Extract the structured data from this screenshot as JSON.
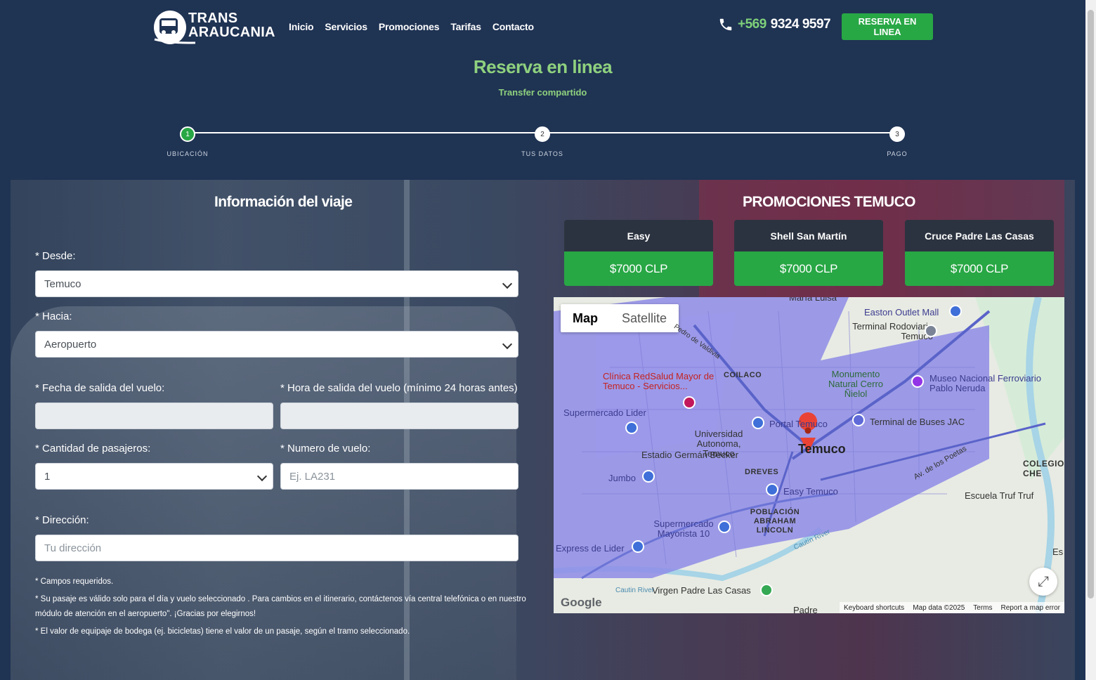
{
  "header": {
    "logo_line1": "TRANS",
    "logo_line2": "ARAUCANIA",
    "nav": [
      "Inicio",
      "Servicios",
      "Promociones",
      "Tarifas",
      "Contacto"
    ],
    "phone_prefix": "+569",
    "phone_number": "9324 9597",
    "book_button": "RESERVA EN LINEA"
  },
  "hero": {
    "title": "Reserva en linea",
    "subtitle": "Transfer compartido"
  },
  "steps": [
    {
      "num": "1",
      "label": "UBICACIÓN"
    },
    {
      "num": "2",
      "label": "TUS DATOS"
    },
    {
      "num": "3",
      "label": "PAGO"
    }
  ],
  "form": {
    "title": "Información del viaje",
    "desde_label": "* Desde:",
    "desde_value": " Temuco",
    "hacia_label": "* Hacia:",
    "hacia_value": " Aeropuerto",
    "fecha_label": "* Fecha de salida del vuelo:",
    "hora_label": "* Hora de salida del vuelo (mínimo 24 horas antes)",
    "pasajeros_label": "* Cantidad de pasajeros:",
    "pasajeros_value": "1",
    "vuelo_label": "* Numero de vuelo:",
    "vuelo_placeholder": "Ej. LA231",
    "direccion_label": "* Dirección:",
    "direccion_placeholder": "Tu dirección",
    "notes": [
      "* Campos requeridos.",
      "* Su pasaje es válido solo para el día y vuelo seleccionado . Para cambios en el itinerario, contáctenos vía central telefónica o en nuestro módulo de atención en el aeropuerto\". ¡Gracias por elegirnos!",
      "* El valor de equipaje de bodega (ej. bicicletas) tiene el valor de un pasaje, según el tramo seleccionado."
    ]
  },
  "promos": {
    "title": "PROMOCIONES TEMUCO",
    "items": [
      {
        "name": "Easy",
        "price": "$7000 CLP"
      },
      {
        "name": "Shell San Martín",
        "price": "$7000 CLP"
      },
      {
        "name": "Cruce Padre Las Casas",
        "price": "$7000 CLP"
      }
    ]
  },
  "map": {
    "tab_map": "Map",
    "tab_satellite": "Satellite",
    "labels": {
      "maria_luisa": "María Luisa",
      "easton": "Easton Outlet Mall",
      "terminal_rod": "Terminal Rodoviario Temuco",
      "monumento": "Monumento Natural Cerro Ñielol",
      "museo": "Museo Nacional Ferroviario Pablo Neruda",
      "coilaco": "COILACO",
      "clinica": "Clínica RedSalud Mayor de Temuco - Servicios...",
      "lider": "Supermercado Lider",
      "universidad": "Universidad Autonoma, Temuco",
      "portal": "Portal Temuco",
      "terminal_jac": "Terminal de Buses JAC",
      "estadio": "Estadio Germán Becker",
      "temuco": "Temuco",
      "dreves": "DREVES",
      "jumbo": "Jumbo",
      "easy": "Easy Temuco",
      "poblacion": "POBLACIÓN ABRAHAM LINCOLN",
      "mayorista": "Supermercado Mayorista 10",
      "express": "Express de Lider",
      "virgen": "Virgen Padre Las Casas",
      "padre": "Padre",
      "colegio": "COLEGIO CHE",
      "escuela": "Escuela Truf Truf",
      "poetas": "Av. de los Poetas",
      "cautin1": "Cautín River",
      "cautin2": "Cautin River",
      "valdivia": "Pedro de Valdivia",
      "es": "Es"
    },
    "google": "Google",
    "attrib": [
      "Keyboard shortcuts",
      "Map data ©2025",
      "Terms",
      "Report a map error"
    ]
  },
  "colors": {
    "background": "#1f3353",
    "accent_green": "#28a745",
    "title_green": "#8fd17e"
  }
}
